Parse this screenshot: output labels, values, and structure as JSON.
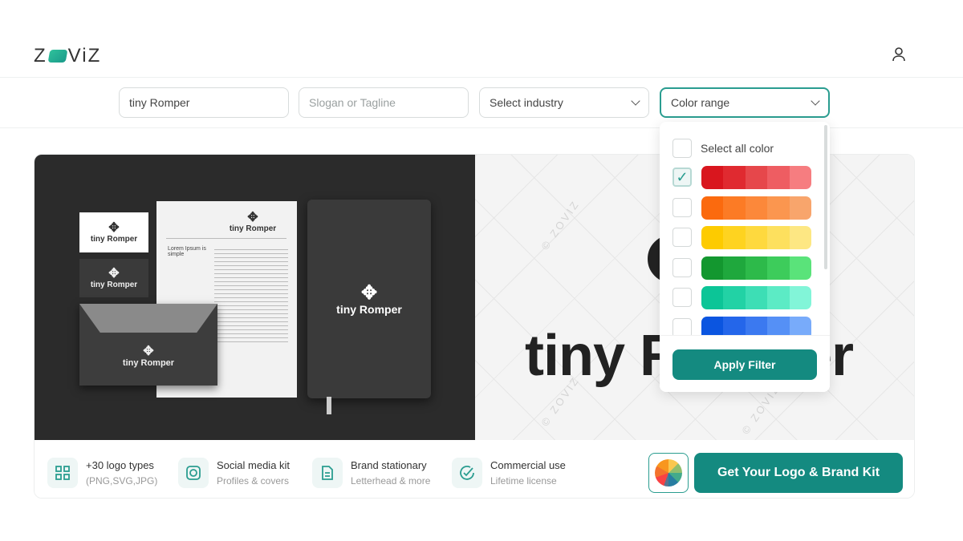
{
  "header": {
    "brand": "ZOVIZ",
    "user_icon": "user-icon"
  },
  "filters": {
    "name_value": "tiny Romper",
    "slogan_placeholder": "Slogan or Tagline",
    "industry_label": "Select industry",
    "color_label": "Color range"
  },
  "preview": {
    "brand_name": "tiny Romper",
    "watermark": "© ZOVIZ",
    "letterhead_heading": "Lorem Ipsum is simple"
  },
  "features": [
    {
      "title": "+30 logo types",
      "sub": "(PNG,SVG,JPG)",
      "icon": "grid-icon"
    },
    {
      "title": "Social media kit",
      "sub": "Profiles & covers",
      "icon": "instagram-icon"
    },
    {
      "title": "Brand stationary",
      "sub": "Letterhead & more",
      "icon": "document-icon"
    },
    {
      "title": "Commercial use",
      "sub": "Lifetime license",
      "icon": "check-circle-icon"
    }
  ],
  "cta": {
    "label": "Get Your Logo & Brand Kit"
  },
  "color_dropdown": {
    "select_all": "Select all color",
    "apply": "Apply Filter",
    "ranges": [
      {
        "name": "red",
        "checked": true,
        "colors": [
          "#d9161e",
          "#e02a30",
          "#e6474b",
          "#ee5d62",
          "#f67d80"
        ]
      },
      {
        "name": "orange",
        "checked": false,
        "colors": [
          "#fb6a0e",
          "#fc7b25",
          "#fc883a",
          "#fb964f",
          "#f8a56c"
        ]
      },
      {
        "name": "yellow",
        "checked": false,
        "colors": [
          "#fdcb00",
          "#fed320",
          "#fed93e",
          "#fde05e",
          "#fde783"
        ]
      },
      {
        "name": "green",
        "checked": false,
        "colors": [
          "#13972f",
          "#1fa83d",
          "#2dba4a",
          "#3dcc5b",
          "#5ae37a"
        ]
      },
      {
        "name": "teal",
        "checked": false,
        "colors": [
          "#0cc597",
          "#22d2a5",
          "#3ddeb5",
          "#5cebc5",
          "#82f5d8"
        ]
      },
      {
        "name": "blue",
        "checked": false,
        "colors": [
          "#0b55e0",
          "#2466ea",
          "#3b79f0",
          "#5590f6",
          "#78abfa"
        ]
      }
    ]
  }
}
